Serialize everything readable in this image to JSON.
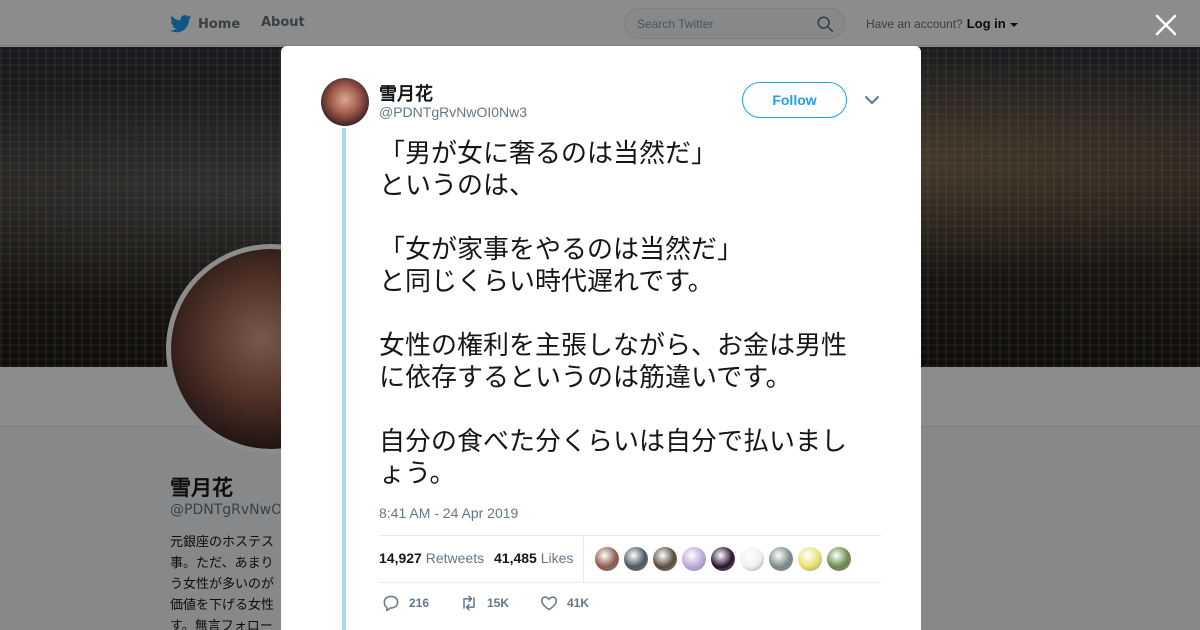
{
  "topnav": {
    "home_label": "Home",
    "about_label": "About",
    "search_placeholder": "Search Twitter",
    "account_prompt": "Have an account?",
    "login_label": "Log in"
  },
  "profile": {
    "name": "雪月花",
    "handle": "@PDNTgRvNwOI0Nw3",
    "bio_lines": [
      "元銀座のホステス",
      "事。ただ、あまり",
      "う女性が多いのが",
      "価値を下げる女性",
      "す。無言フォロー"
    ]
  },
  "tweet": {
    "author_name": "雪月花",
    "author_handle": "@PDNTgRvNwOI0Nw3",
    "follow_label": "Follow",
    "lines": [
      "「男が女に奢るのは当然だ」",
      "というのは、",
      "",
      "「女が家事をやるのは当然だ」",
      "と同じくらい時代遅れです。",
      "",
      "女性の権利を主張しながら、お金は男性",
      "に依存するというのは筋違いです。",
      "",
      "自分の食べた分くらいは自分で払いまし",
      "ょう。"
    ],
    "timestamp": "8:41 AM - 24 Apr 2019",
    "retweets_count": "14,927",
    "retweets_label": "Retweets",
    "likes_count": "41,485",
    "likes_label": "Likes",
    "replies_short": "216",
    "retweets_short": "15K",
    "likes_short": "41K"
  },
  "likers": [
    {
      "name": "liker-avatar-1",
      "color": "#8a5a4a"
    },
    {
      "name": "liker-avatar-2",
      "color": "#4a5560"
    },
    {
      "name": "liker-avatar-3",
      "color": "#5a4a3a"
    },
    {
      "name": "liker-avatar-4",
      "color": "#b8a8d8"
    },
    {
      "name": "liker-avatar-5",
      "color": "#2a1030"
    },
    {
      "name": "liker-avatar-6",
      "color": "#f0f0f0"
    },
    {
      "name": "liker-avatar-7",
      "color": "#7a8a88"
    },
    {
      "name": "liker-avatar-8",
      "color": "#e8e070"
    },
    {
      "name": "liker-avatar-9",
      "color": "#6a8a4a"
    }
  ],
  "colors": {
    "brand": "#1da1f2",
    "thread_line": "#a9d8f5",
    "text": "#14171a",
    "muted": "#657786"
  }
}
